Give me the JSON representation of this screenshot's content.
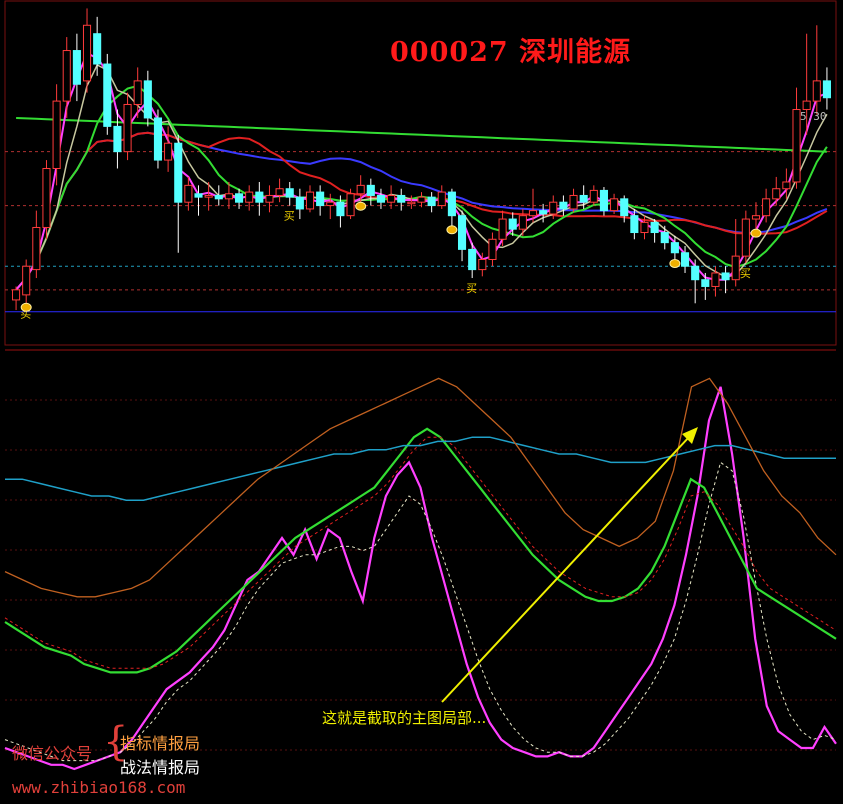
{
  "title": "000027 深圳能源",
  "annotation": "这就是截取的主图局部...",
  "price_label": "5.30",
  "buy_marker": "买",
  "watermark": {
    "line1": "微信公众号",
    "line2": "指标情报局",
    "line3": "战法情报局",
    "url": "www.zhibiao168.com"
  },
  "colors": {
    "background": "#000000",
    "up_candle": "#ff3b3b",
    "down_candle": "#54ffff",
    "ma_fast": "#ff40ff",
    "ma_slow": "#c8c8a0",
    "ma_mid": "#33dd33",
    "ma_long": "#e02020",
    "ma_blue": "#3a3aff",
    "long_green": "#33dd33",
    "osc_main": "#ff40ff",
    "osc_signal": "#e8e8c8",
    "osc_green": "#33dd33",
    "osc_red": "#e02020",
    "osc_cyan": "#1fa0c8",
    "osc_brown": "#c06020",
    "arrow": "#f0f000"
  },
  "chart_data": [
    {
      "type": "candlestick",
      "panel": "main",
      "title": "000027 深圳能源",
      "y_range": [
        4.2,
        6.2
      ],
      "reference_levels": [
        5.3,
        4.98,
        4.62,
        4.48,
        4.35
      ],
      "candles": [
        [
          4.42,
          4.48,
          4.36,
          4.5
        ],
        [
          4.45,
          4.62,
          4.4,
          4.66
        ],
        [
          4.6,
          4.85,
          4.55,
          4.95
        ],
        [
          4.85,
          5.2,
          4.78,
          5.25
        ],
        [
          5.2,
          5.6,
          5.1,
          5.7
        ],
        [
          5.6,
          5.9,
          5.5,
          5.98
        ],
        [
          5.9,
          5.7,
          5.6,
          6.0
        ],
        [
          5.72,
          6.05,
          5.65,
          6.15
        ],
        [
          6.0,
          5.82,
          5.75,
          6.1
        ],
        [
          5.82,
          5.45,
          5.4,
          5.88
        ],
        [
          5.45,
          5.3,
          5.2,
          5.55
        ],
        [
          5.3,
          5.58,
          5.25,
          5.65
        ],
        [
          5.58,
          5.72,
          5.5,
          5.8
        ],
        [
          5.72,
          5.5,
          5.45,
          5.78
        ],
        [
          5.5,
          5.25,
          5.2,
          5.55
        ],
        [
          5.25,
          5.35,
          5.18,
          5.45
        ],
        [
          5.35,
          5.0,
          4.7,
          5.4
        ],
        [
          5.0,
          5.1,
          4.95,
          5.15
        ],
        [
          5.05,
          5.03,
          4.92,
          5.1
        ],
        [
          5.03,
          5.04,
          4.95,
          5.12
        ],
        [
          5.04,
          5.02,
          4.98,
          5.1
        ],
        [
          5.02,
          5.05,
          4.96,
          5.12
        ],
        [
          5.05,
          5.0,
          4.96,
          5.08
        ],
        [
          5.0,
          5.06,
          4.95,
          5.1
        ],
        [
          5.06,
          5.0,
          4.92,
          5.12
        ],
        [
          5.0,
          5.04,
          4.94,
          5.1
        ],
        [
          5.04,
          5.08,
          5.0,
          5.14
        ],
        [
          5.08,
          5.03,
          4.98,
          5.12
        ],
        [
          5.03,
          4.96,
          4.9,
          5.08
        ],
        [
          4.96,
          5.06,
          4.94,
          5.1
        ],
        [
          5.06,
          4.98,
          4.92,
          5.1
        ],
        [
          4.98,
          5.0,
          4.9,
          5.05
        ],
        [
          5.0,
          4.92,
          4.85,
          5.04
        ],
        [
          4.92,
          5.05,
          4.9,
          5.08
        ],
        [
          5.05,
          5.1,
          5.0,
          5.16
        ],
        [
          5.1,
          5.04,
          4.98,
          5.14
        ],
        [
          5.04,
          5.0,
          4.96,
          5.08
        ],
        [
          5.0,
          5.04,
          4.96,
          5.1
        ],
        [
          5.04,
          5.0,
          4.95,
          5.08
        ],
        [
          5.0,
          5.0,
          4.96,
          5.04
        ],
        [
          5.0,
          5.03,
          4.97,
          5.06
        ],
        [
          5.03,
          4.98,
          4.94,
          5.06
        ],
        [
          4.98,
          5.06,
          4.96,
          5.1
        ],
        [
          5.06,
          4.92,
          4.86,
          5.08
        ],
        [
          4.92,
          4.72,
          4.65,
          4.95
        ],
        [
          4.72,
          4.6,
          4.55,
          4.76
        ],
        [
          4.6,
          4.66,
          4.56,
          4.7
        ],
        [
          4.66,
          4.78,
          4.62,
          4.82
        ],
        [
          4.78,
          4.9,
          4.74,
          4.95
        ],
        [
          4.9,
          4.84,
          4.8,
          4.94
        ],
        [
          4.84,
          4.92,
          4.8,
          4.96
        ],
        [
          4.92,
          4.95,
          4.88,
          5.08
        ],
        [
          4.95,
          4.93,
          4.88,
          4.99
        ],
        [
          4.93,
          5.0,
          4.9,
          5.04
        ],
        [
          5.0,
          4.96,
          4.92,
          5.04
        ],
        [
          4.96,
          5.04,
          4.94,
          5.08
        ],
        [
          5.04,
          5.0,
          4.96,
          5.1
        ],
        [
          5.0,
          5.07,
          4.98,
          5.1
        ],
        [
          5.07,
          4.95,
          4.92,
          5.09
        ],
        [
          4.95,
          5.02,
          4.93,
          5.05
        ],
        [
          5.02,
          4.92,
          4.88,
          5.04
        ],
        [
          4.92,
          4.82,
          4.78,
          4.96
        ],
        [
          4.82,
          4.88,
          4.78,
          4.92
        ],
        [
          4.88,
          4.82,
          4.76,
          4.9
        ],
        [
          4.82,
          4.76,
          4.72,
          4.86
        ],
        [
          4.76,
          4.7,
          4.66,
          4.8
        ],
        [
          4.7,
          4.62,
          4.58,
          4.74
        ],
        [
          4.62,
          4.54,
          4.4,
          4.66
        ],
        [
          4.54,
          4.5,
          4.42,
          4.58
        ],
        [
          4.5,
          4.58,
          4.44,
          4.62
        ],
        [
          4.58,
          4.54,
          4.46,
          4.62
        ],
        [
          4.54,
          4.68,
          4.5,
          4.9
        ],
        [
          4.68,
          4.9,
          4.64,
          4.95
        ],
        [
          4.9,
          4.92,
          4.84,
          5.0
        ],
        [
          4.92,
          5.02,
          4.88,
          5.08
        ],
        [
          5.02,
          5.08,
          4.98,
          5.15
        ],
        [
          5.08,
          5.12,
          5.02,
          5.2
        ],
        [
          5.12,
          5.55,
          5.08,
          5.68
        ],
        [
          5.55,
          5.6,
          5.4,
          6.0
        ],
        [
          5.6,
          5.72,
          5.52,
          6.05
        ],
        [
          5.72,
          5.62,
          5.55,
          5.8
        ]
      ],
      "buy_signals": [
        1,
        27,
        45,
        72
      ],
      "gold_dots": [
        1,
        34,
        43,
        65,
        73
      ]
    },
    {
      "type": "line",
      "panel": "indicator",
      "y_range": [
        0,
        100
      ],
      "series": [
        {
          "values": [
            10,
            9,
            8,
            7,
            6,
            6,
            5,
            6,
            7,
            8,
            9,
            12,
            16,
            20,
            24,
            26,
            28,
            31,
            34,
            38,
            44,
            50,
            52,
            56,
            60,
            56,
            62,
            55,
            62,
            60,
            52,
            45,
            60,
            70,
            75,
            78,
            72,
            60,
            50,
            40,
            30,
            22,
            16,
            12,
            10,
            9,
            8,
            8,
            9,
            8,
            8,
            10,
            14,
            18,
            22,
            26,
            30,
            36,
            44,
            56,
            70,
            88,
            96,
            80,
            60,
            36,
            20,
            14,
            12,
            10,
            10,
            15,
            11
          ]
        },
        {
          "values": [
            12,
            11,
            10,
            9,
            8,
            7,
            7,
            7,
            7,
            8,
            9,
            11,
            14,
            17,
            21,
            24,
            26,
            29,
            32,
            35,
            39,
            44,
            48,
            51,
            54,
            55,
            56,
            56,
            57,
            58,
            58,
            57,
            58,
            62,
            66,
            70,
            68,
            62,
            55,
            47,
            39,
            31,
            24,
            19,
            15,
            12,
            10,
            9,
            9,
            8,
            8,
            9,
            11,
            14,
            17,
            21,
            25,
            30,
            36,
            45,
            56,
            68,
            78,
            76,
            65,
            50,
            36,
            25,
            18,
            14,
            12,
            13,
            12
          ]
        },
        {
          "values": [
            40,
            38,
            36,
            34,
            33,
            32,
            30,
            29,
            28,
            28,
            28,
            29,
            31,
            33,
            36,
            39,
            42,
            45,
            48,
            51,
            54,
            57,
            60,
            62,
            64,
            66,
            68,
            70,
            72,
            76,
            80,
            84,
            86,
            84,
            80,
            76,
            72,
            68,
            64,
            60,
            56,
            53,
            50,
            48,
            46,
            45,
            45,
            46,
            48,
            52,
            58,
            66,
            74,
            72,
            66,
            60,
            54,
            48,
            46,
            44,
            42,
            40,
            38,
            36
          ]
        },
        {
          "values": [
            41,
            39,
            37,
            35,
            34,
            33,
            31,
            30,
            29,
            29,
            29,
            29,
            30,
            32,
            34,
            37,
            40,
            43,
            46,
            49,
            52,
            55,
            58,
            60,
            62,
            64,
            66,
            68,
            70,
            73,
            77,
            81,
            84,
            84,
            82,
            78,
            74,
            70,
            66,
            62,
            58,
            55,
            52,
            50,
            48,
            47,
            46,
            46,
            47,
            50,
            55,
            62,
            70,
            71,
            68,
            63,
            58,
            52,
            48,
            46,
            44,
            42,
            40,
            38
          ]
        },
        {
          "values": [
            74,
            74,
            73,
            72,
            71,
            70,
            70,
            69,
            69,
            70,
            71,
            72,
            73,
            74,
            75,
            76,
            77,
            78,
            79,
            80,
            80,
            81,
            81,
            82,
            82,
            83,
            83,
            84,
            84,
            83,
            82,
            81,
            80,
            80,
            79,
            78,
            78,
            78,
            79,
            80,
            81,
            82,
            82,
            81,
            80,
            79,
            79,
            79,
            79
          ]
        },
        {
          "values": [
            52,
            50,
            48,
            47,
            46,
            46,
            47,
            48,
            50,
            54,
            58,
            62,
            66,
            70,
            74,
            77,
            80,
            83,
            86,
            88,
            90,
            92,
            94,
            96,
            98,
            96,
            92,
            88,
            84,
            78,
            72,
            66,
            62,
            60,
            58,
            60,
            64,
            76,
            96,
            98,
            92,
            84,
            76,
            70,
            66,
            60,
            56
          ]
        }
      ]
    }
  ]
}
